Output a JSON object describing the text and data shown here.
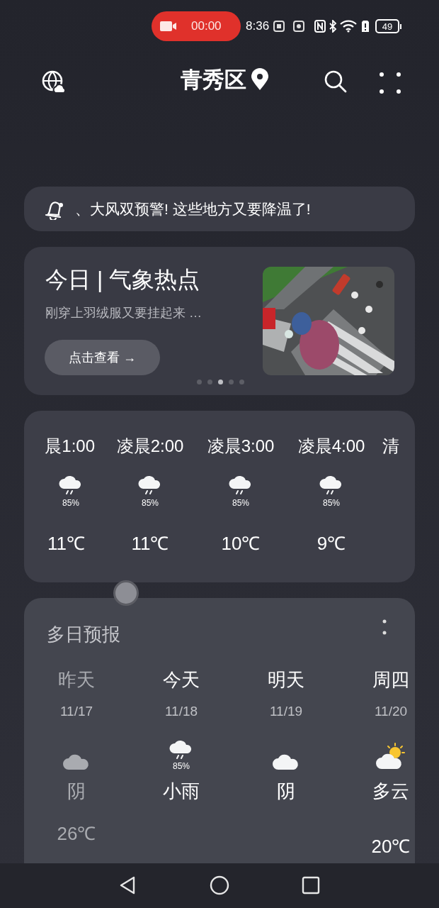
{
  "status_bar": {
    "recording_time": "00:00",
    "time": "8:36",
    "battery": "49"
  },
  "header": {
    "location": "青秀区"
  },
  "alert_ticker": {
    "text": "、大风双预警!  这些地方又要降温了!"
  },
  "hotspot": {
    "title": "今日 | 气象热点",
    "subtitle": "刚穿上羽绒服又要挂起来 …",
    "button": "点击查看 →",
    "pages": [
      {
        "selected": false
      },
      {
        "selected": false
      },
      {
        "selected": true
      },
      {
        "selected": false
      },
      {
        "selected": false
      }
    ]
  },
  "hourly": [
    {
      "time": "晨1:00",
      "kind": "rain",
      "precip": "85%",
      "temp": "11℃"
    },
    {
      "time": "凌晨2:00",
      "kind": "rain",
      "precip": "85%",
      "temp": "11℃"
    },
    {
      "time": "凌晨3:00",
      "kind": "rain",
      "precip": "85%",
      "temp": "10℃"
    },
    {
      "time": "凌晨4:00",
      "kind": "rain",
      "precip": "85%",
      "temp": "9℃"
    },
    {
      "time": "清"
    }
  ],
  "forecast": {
    "title": "多日预报",
    "days": [
      {
        "day": "昨天",
        "date": "11/17",
        "kind": "cloudy",
        "condition": "阴",
        "high": "26℃",
        "past": true
      },
      {
        "day": "今天",
        "date": "11/18",
        "kind": "rain",
        "precip": "85%",
        "condition": "小雨",
        "past": false
      },
      {
        "day": "明天",
        "date": "11/19",
        "kind": "cloudy",
        "condition": "阴",
        "past": false
      },
      {
        "day": "周四",
        "date": "11/20",
        "kind": "partly_cloudy",
        "condition": "多云",
        "high": "20℃",
        "past": false
      }
    ]
  }
}
